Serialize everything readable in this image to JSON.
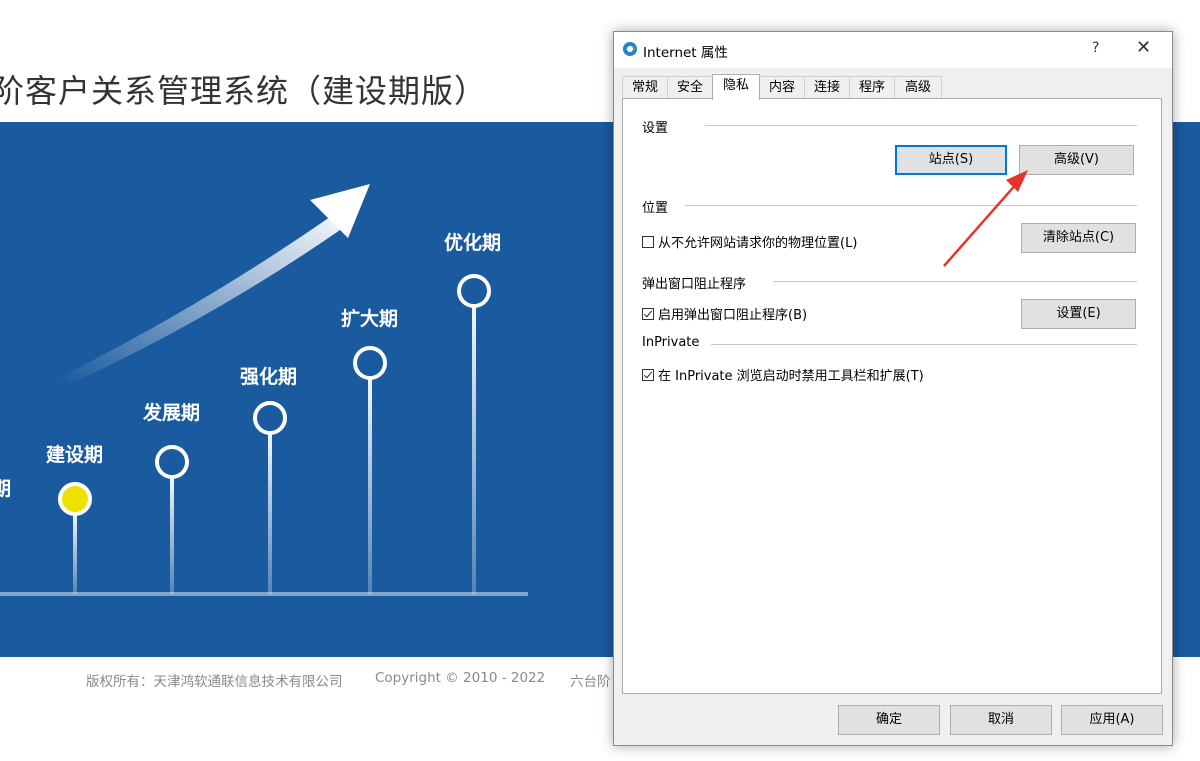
{
  "background_page": {
    "title": "阶客户关系管理系统（建设期版）",
    "stages": [
      {
        "label": "期"
      },
      {
        "label": "建设期"
      },
      {
        "label": "发展期"
      },
      {
        "label": "强化期"
      },
      {
        "label": "扩大期"
      },
      {
        "label": "优化期"
      }
    ],
    "active_stage_color": "#f0e000",
    "banner_color": "#1a5a9e",
    "footer": {
      "copyright_owner": "版权所有：天津鸿软通联信息技术有限公司",
      "copyright": "Copyright © 2010 - 2022",
      "extra": "六台阶"
    }
  },
  "dialog": {
    "title": "Internet 属性",
    "help_symbol": "?",
    "close_symbol": "✕",
    "icon": "internet-explorer-icon",
    "tabs": [
      {
        "label": "常规"
      },
      {
        "label": "安全"
      },
      {
        "label": "隐私"
      },
      {
        "label": "内容"
      },
      {
        "label": "连接"
      },
      {
        "label": "程序"
      },
      {
        "label": "高级"
      }
    ],
    "active_tab": "隐私",
    "settings": {
      "label": "设置",
      "sites_button": "站点(S)",
      "advanced_button": "高级(V)"
    },
    "location": {
      "label": "位置",
      "checkbox_label": "从不允许网站请求你的物理位置(L)",
      "checked": false,
      "clear_sites_button": "清除站点(C)"
    },
    "popup_blocker": {
      "label": "弹出窗口阻止程序",
      "checkbox_label": "启用弹出窗口阻止程序(B)",
      "checked": true,
      "settings_button": "设置(E)"
    },
    "inprivate": {
      "label": "InPrivate",
      "checkbox_label": "在 InPrivate 浏览启动时禁用工具栏和扩展(T)",
      "checked": true
    },
    "footer_buttons": {
      "ok": "确定",
      "cancel": "取消",
      "apply": "应用(A)"
    }
  },
  "annotation": {
    "arrow_color": "#e8322c"
  }
}
